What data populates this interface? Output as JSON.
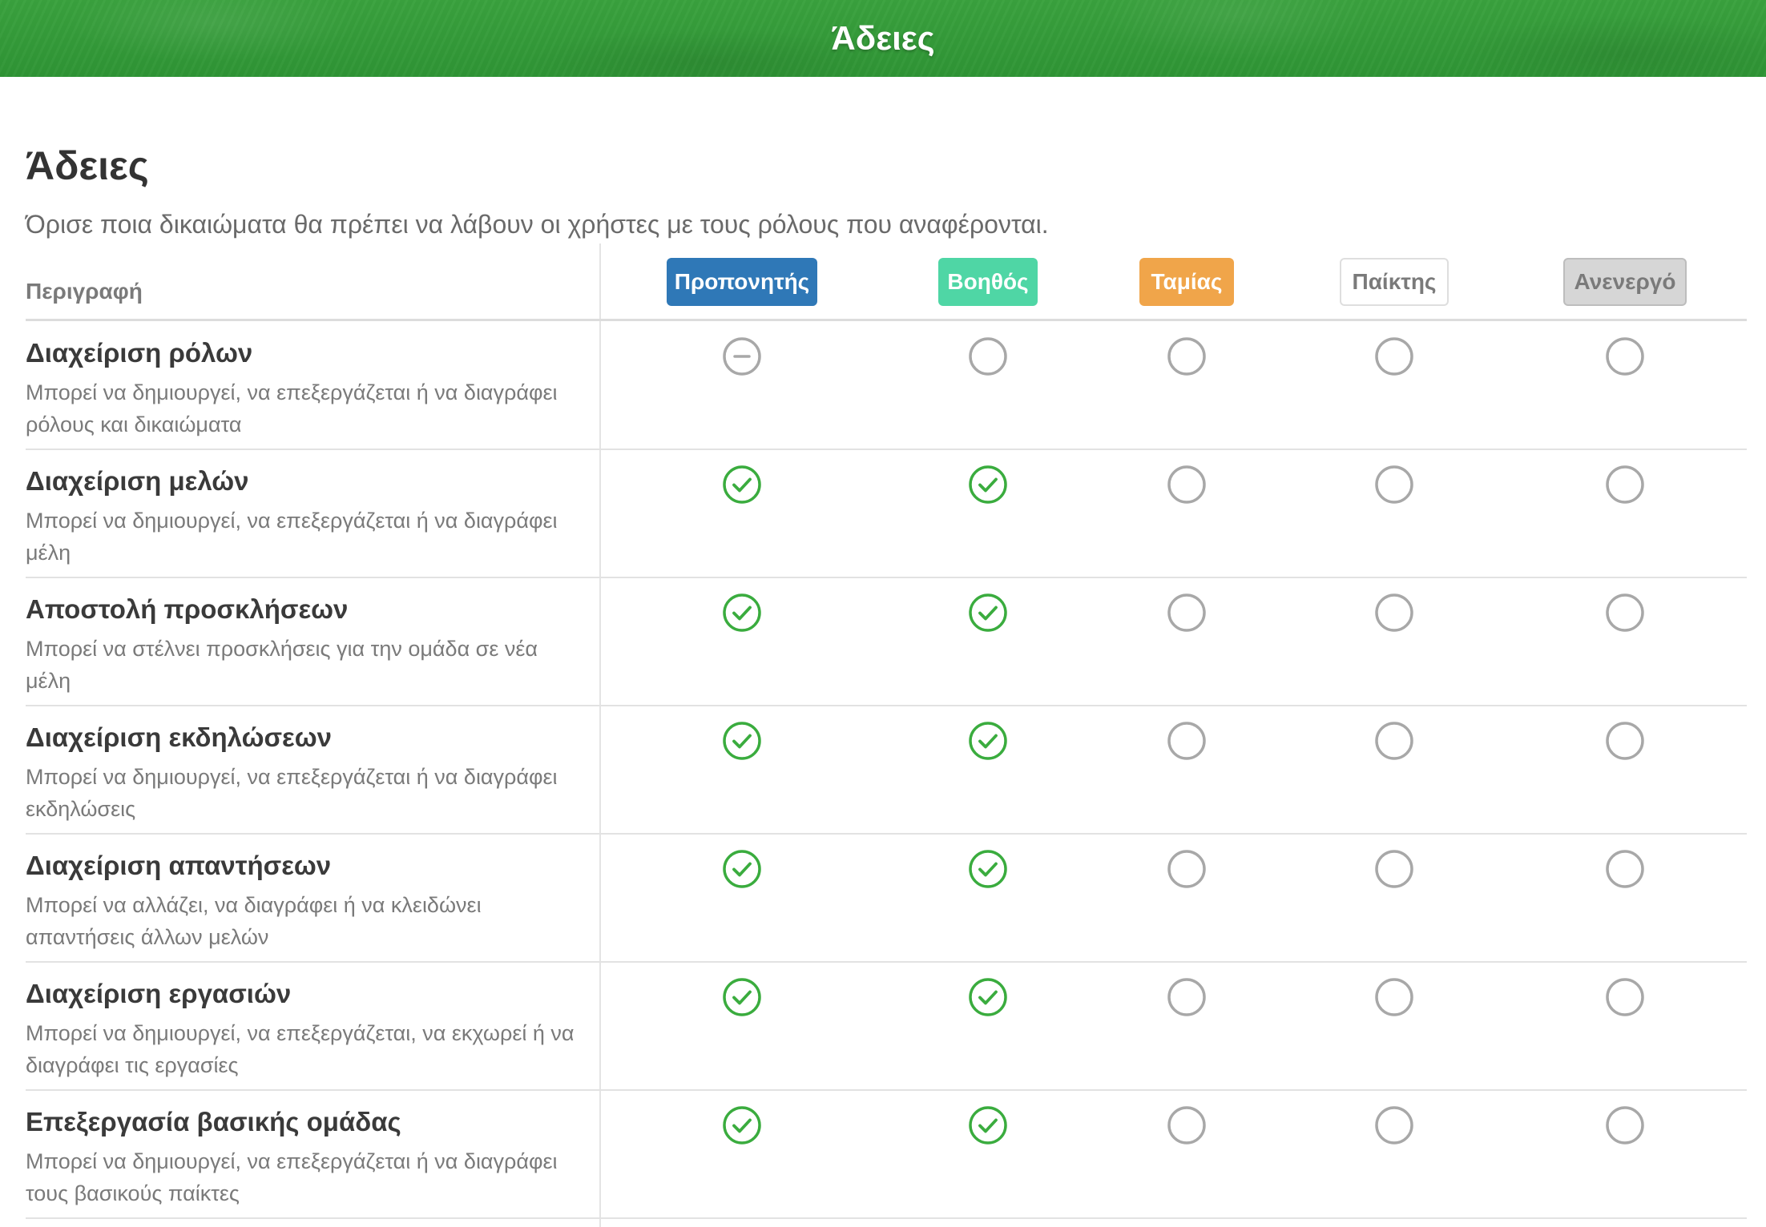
{
  "topbar": {
    "title": "Άδειες"
  },
  "page": {
    "title": "Άδειες",
    "subtitle": "Όρισε ποια δικαιώματα θα πρέπει να λάβουν οι χρήστες με τους ρόλους που αναφέρονται."
  },
  "table": {
    "description_header": "Περιγραφή",
    "roles": [
      {
        "label": "Προπονητής",
        "color": "#2f78b7"
      },
      {
        "label": "Βοηθός",
        "color": "#4fd6a5"
      },
      {
        "label": "Ταμίας",
        "color": "#f0a54a"
      },
      {
        "label": "Παίκτης",
        "color": "#ffffff"
      },
      {
        "label": "Ανενεργό",
        "color": "#d6d6d6"
      }
    ],
    "rows": [
      {
        "title": "Διαχείριση ρόλων",
        "description": "Μπορεί να δημιουργεί, να επεξεργάζεται ή να διαγράφει ρόλους και δικαιώματα",
        "states": [
          "locked",
          "off",
          "off",
          "off",
          "off"
        ]
      },
      {
        "title": "Διαχείριση μελών",
        "description": "Μπορεί να δημιουργεί, να επεξεργάζεται ή να διαγράφει μέλη",
        "states": [
          "on",
          "on",
          "off",
          "off",
          "off"
        ]
      },
      {
        "title": "Αποστολή προσκλήσεων",
        "description": "Μπορεί να στέλνει προσκλήσεις για την ομάδα σε νέα μέλη",
        "states": [
          "on",
          "on",
          "off",
          "off",
          "off"
        ]
      },
      {
        "title": "Διαχείριση εκδηλώσεων",
        "description": "Μπορεί να δημιουργεί, να επεξεργάζεται ή να διαγράφει εκδηλώσεις",
        "states": [
          "on",
          "on",
          "off",
          "off",
          "off"
        ]
      },
      {
        "title": "Διαχείριση απαντήσεων",
        "description": "Μπορεί να αλλάζει, να διαγράφει ή να κλειδώνει απαντήσεις άλλων μελών",
        "states": [
          "on",
          "on",
          "off",
          "off",
          "off"
        ]
      },
      {
        "title": "Διαχείριση εργασιών",
        "description": "Μπορεί να δημιουργεί, να επεξεργάζεται, να εκχωρεί ή να διαγράφει τις εργασίες",
        "states": [
          "on",
          "on",
          "off",
          "off",
          "off"
        ]
      },
      {
        "title": "Επεξεργασία βασικής ομάδας",
        "description": "Μπορεί να δημιουργεί, να επεξεργάζεται ή να διαγράφει τους βασικούς παίκτες",
        "states": [
          "on",
          "on",
          "off",
          "off",
          "off"
        ]
      }
    ]
  },
  "colors": {
    "check_green": "#3aac3e",
    "circle_gray": "#a8a8a8"
  }
}
